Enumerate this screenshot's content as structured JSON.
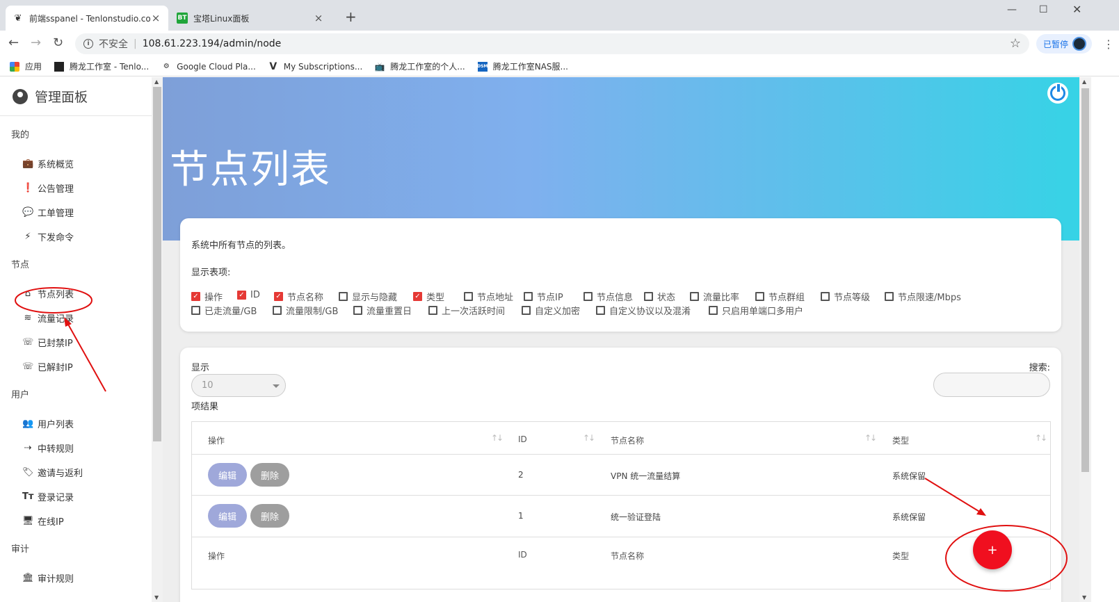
{
  "browser": {
    "tabs": [
      {
        "title": "前端sspanel - Tenlonstudio.co",
        "favicon": "ss",
        "active": true
      },
      {
        "title": "宝塔Linux面板",
        "favicon": "BT",
        "active": false
      }
    ],
    "insecure_label": "不安全",
    "url": "108.61.223.194/admin/node",
    "profile_label": "已暂停",
    "bookmarks": [
      {
        "label": "应用",
        "icon": "apps-icon"
      },
      {
        "label": "腾龙工作室 - Tenlo...",
        "icon": "dark-square-icon"
      },
      {
        "label": "Google Cloud Pla...",
        "icon": "gear-icon"
      },
      {
        "label": "My Subscriptions...",
        "icon": "v-logo-icon"
      },
      {
        "label": "腾龙工作室的个人...",
        "icon": "tv-icon"
      },
      {
        "label": "腾龙工作室NAS服...",
        "icon": "dsm-icon"
      }
    ]
  },
  "sidebar": {
    "title": "管理面板",
    "sections": [
      {
        "label": "我的",
        "items": [
          "系统概览",
          "公告管理",
          "工单管理",
          "下发命令"
        ]
      },
      {
        "label": "节点",
        "items": [
          "节点列表",
          "流量记录",
          "已封禁IP",
          "已解封IP"
        ]
      },
      {
        "label": "用户",
        "items": [
          "用户列表",
          "中转规则",
          "邀请与返利",
          "登录记录",
          "在线IP"
        ]
      },
      {
        "label": "审计",
        "items": [
          "审计规则"
        ]
      }
    ]
  },
  "page": {
    "title": "节点列表",
    "description": "系统中所有节点的列表。",
    "columns_label": "显示表项:",
    "columns": [
      {
        "label": "操作",
        "checked": true
      },
      {
        "label": "ID",
        "checked": true
      },
      {
        "label": "节点名称",
        "checked": true
      },
      {
        "label": "显示与隐藏",
        "checked": false
      },
      {
        "label": "类型",
        "checked": true
      },
      {
        "label": "节点地址",
        "checked": false
      },
      {
        "label": "节点IP",
        "checked": false
      },
      {
        "label": "节点信息",
        "checked": false
      },
      {
        "label": "状态",
        "checked": false
      },
      {
        "label": "流量比率",
        "checked": false
      },
      {
        "label": "节点群组",
        "checked": false
      },
      {
        "label": "节点等级",
        "checked": false
      },
      {
        "label": "节点限速/Mbps",
        "checked": false
      },
      {
        "label": "已走流量/GB",
        "checked": false
      },
      {
        "label": "流量限制/GB",
        "checked": false
      },
      {
        "label": "流量重置日",
        "checked": false
      },
      {
        "label": "上一次活跃时间",
        "checked": false
      },
      {
        "label": "自定义加密",
        "checked": false
      },
      {
        "label": "自定义协议以及混淆",
        "checked": false
      },
      {
        "label": "只启用单端口多用户",
        "checked": false
      }
    ]
  },
  "table_controls": {
    "show_label": "显示",
    "page_size": "10",
    "results_label": "项结果",
    "search_label": "搜索:"
  },
  "table": {
    "headers": [
      "操作",
      "ID",
      "节点名称",
      "类型"
    ],
    "rows": [
      {
        "id": "2",
        "name": "VPN 统一流量结算",
        "type": "系统保留"
      },
      {
        "id": "1",
        "name": "统一验证登陆",
        "type": "系统保留"
      }
    ],
    "edit_label": "编辑",
    "delete_label": "删除"
  },
  "fab_label": "+",
  "colors": {
    "accent": "#f00f1f",
    "annotation": "#e01010",
    "edit_button": "#9fa8da",
    "delete_button": "#9e9e9e"
  }
}
